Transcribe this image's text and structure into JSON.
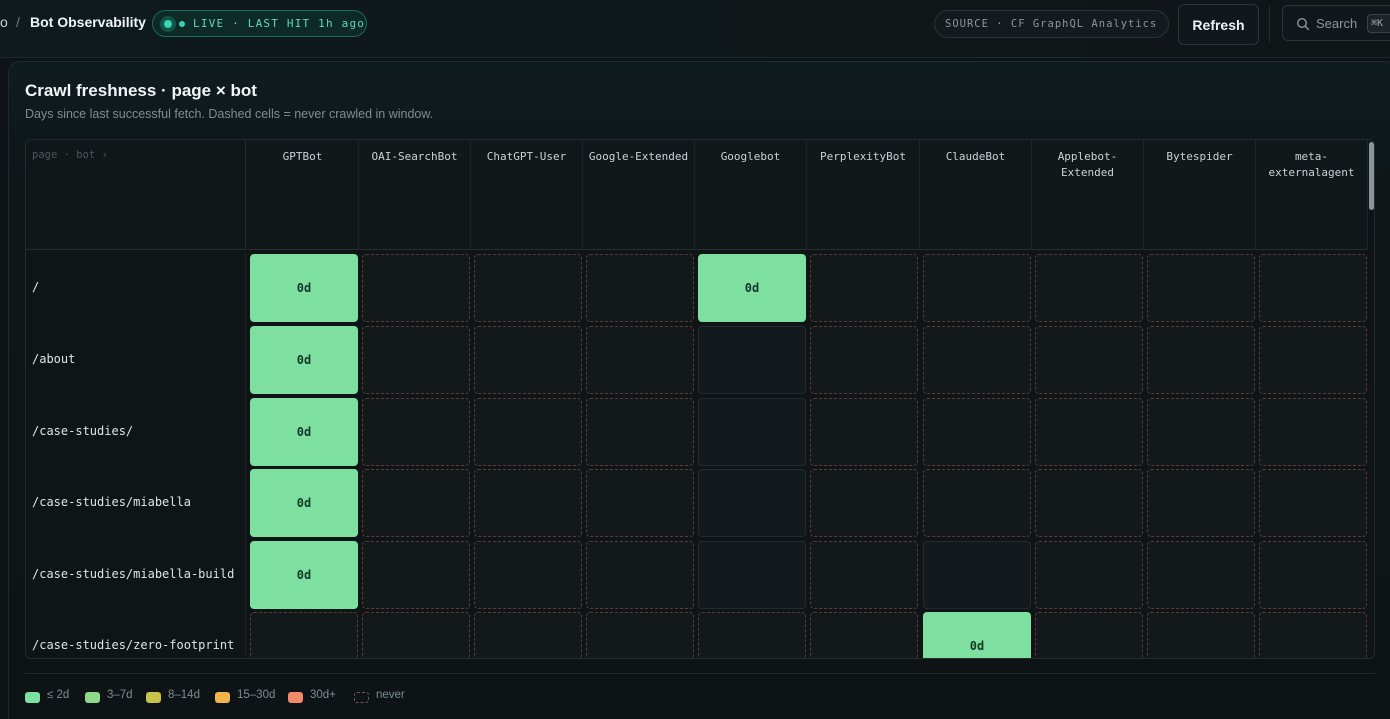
{
  "header": {
    "breadcrumb_prev": "o",
    "breadcrumb_sep": "/",
    "title": "Bot Observability",
    "live_status": "LIVE · LAST HIT 1h ago",
    "source_label": "SOURCE · CF GraphQL Analytics",
    "refresh_label": "Refresh",
    "search_placeholder": "Search",
    "search_shortcut": "⌘K"
  },
  "panel": {
    "title": "Crawl freshness · page × bot",
    "subtitle": "Days since last successful fetch. Dashed cells = never crawled in window.",
    "corner_label": "page · bot ›"
  },
  "columns": [
    "GPTBot",
    "OAI-SearchBot",
    "ChatGPT-User",
    "Google-Extended",
    "Googlebot",
    "PerplexityBot",
    "ClaudeBot",
    "Applebot-Extended",
    "Bytespider",
    "meta-externalagent"
  ],
  "rows": [
    {
      "page": "/",
      "cells": [
        "0d",
        "never",
        "never",
        "never",
        "0d",
        "never",
        "never",
        "never",
        "never",
        "never"
      ]
    },
    {
      "page": "/about",
      "cells": [
        "0d",
        "never",
        "never",
        "never",
        "empty",
        "never",
        "never",
        "never",
        "never",
        "never"
      ]
    },
    {
      "page": "/case-studies/",
      "cells": [
        "0d",
        "never",
        "never",
        "never",
        "empty",
        "never",
        "never",
        "never",
        "never",
        "never"
      ]
    },
    {
      "page": "/case-studies/miabella",
      "cells": [
        "0d",
        "never",
        "never",
        "never",
        "empty",
        "never",
        "never",
        "never",
        "never",
        "never"
      ]
    },
    {
      "page": "/case-studies/miabella-build",
      "cells": [
        "0d",
        "never",
        "never",
        "never",
        "empty",
        "never",
        "empty",
        "never",
        "never",
        "never"
      ]
    },
    {
      "page": "/case-studies/zero-footprint",
      "cells": [
        "never",
        "never",
        "never",
        "never",
        "never",
        "never",
        "0d",
        "never",
        "never",
        "never"
      ]
    }
  ],
  "legend": [
    {
      "label": "≤ 2d",
      "color": "#7ddfa0"
    },
    {
      "label": "3–7d",
      "color": "#8fd88a"
    },
    {
      "label": "8–14d",
      "color": "#c8c24a"
    },
    {
      "label": "15–30d",
      "color": "#f0b44a"
    },
    {
      "label": "30d+",
      "color": "#f08a6a"
    },
    {
      "label": "never",
      "color": "dashed"
    }
  ]
}
